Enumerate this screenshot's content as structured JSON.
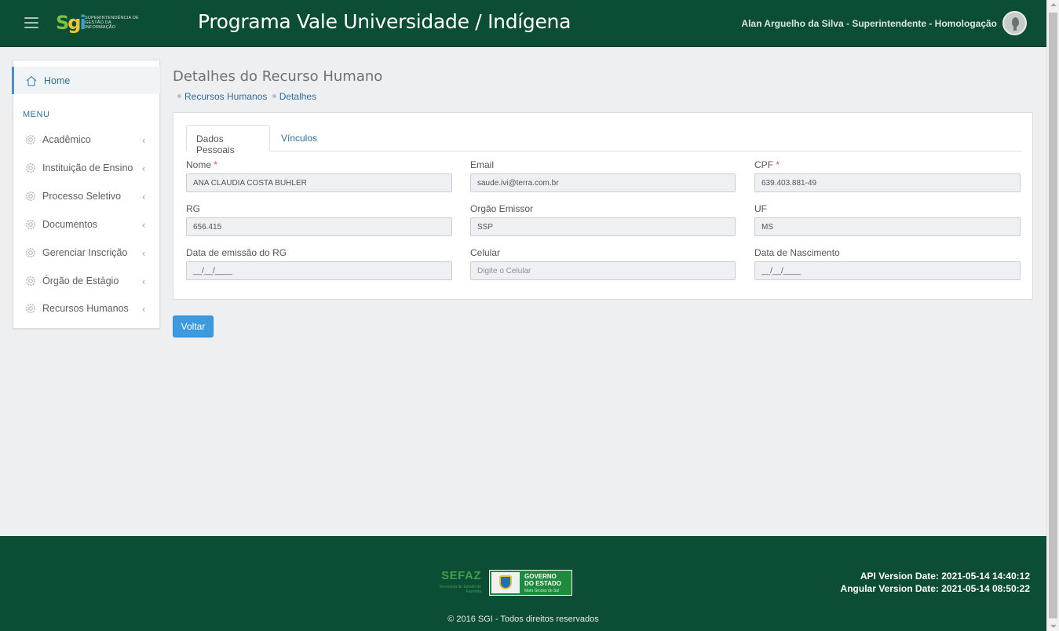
{
  "header": {
    "logo_text": "SGI",
    "logo_sub": "SUPERINTENDÊNCIA DE GESTÃO DA INFORMAÇÃO",
    "title": "Programa Vale Universidade / Indígena",
    "user": "Alan Arguelho da Silva - Superintendente - Homologação"
  },
  "sidebar": {
    "home": "Home",
    "menu_title": "MENU",
    "items": [
      {
        "label": "Acadêmico"
      },
      {
        "label": "Instituição de Ensino"
      },
      {
        "label": "Processo Seletivo"
      },
      {
        "label": "Documentos"
      },
      {
        "label": "Gerenciar Inscrição"
      },
      {
        "label": "Órgão de Estágio"
      },
      {
        "label": "Recursos Humanos"
      }
    ]
  },
  "page": {
    "title": "Detalhes do Recurso Humano",
    "breadcrumb": [
      "Recursos Humanos",
      "Detalhes"
    ]
  },
  "tabs": [
    "Dados Pessoais",
    "Vínculos"
  ],
  "form": {
    "nome": {
      "label": "Nome",
      "required": "*",
      "value": "ANA CLAUDIA COSTA BUHLER"
    },
    "email": {
      "label": "Email",
      "value": "saude.ivi@terra.com.br"
    },
    "cpf": {
      "label": "CPF",
      "required": "*",
      "value": "639.403.881-49"
    },
    "rg": {
      "label": "RG",
      "value": "656.415"
    },
    "orgao": {
      "label": "Orgão Emissor",
      "value": "SSP"
    },
    "uf": {
      "label": "UF",
      "value": "MS"
    },
    "data_rg": {
      "label": "Data de emissão do RG",
      "value": "__/__/____"
    },
    "celular": {
      "label": "Celular",
      "placeholder": "Digite o Celular"
    },
    "nascimento": {
      "label": "Data de Nascimento",
      "value": "__/__/____"
    }
  },
  "buttons": {
    "voltar": "Voltar"
  },
  "footer": {
    "sefaz_title": "SEFAZ",
    "sefaz_sub": "Secretaria de Estado de Fazenda",
    "gov_line1": "GOVERNO",
    "gov_line2": "DO ESTADO",
    "gov_sub": "Mato Grosso do Sul",
    "api_version": "API Version Date: 2021-05-14 14:40:12",
    "angular_version": "Angular Version Date: 2021-05-14 08:50:22",
    "copyright": "© 2016 SGI - Todos direitos reservados"
  },
  "colors": {
    "header_bg": "#0c4d36",
    "accent": "#3c9ade",
    "link": "#2f6fa4",
    "required": "#e34d4d"
  },
  "icons": [
    "menu-icon",
    "home-icon",
    "gear-icon",
    "chevron-left-icon",
    "user-avatar-icon"
  ]
}
